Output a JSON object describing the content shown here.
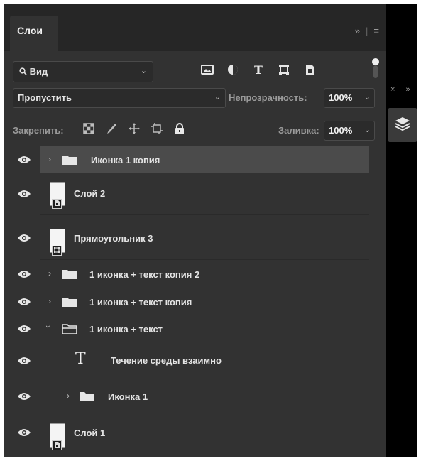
{
  "panel": {
    "tab_label": "Слои"
  },
  "header": {
    "expand_label": "»",
    "divider": "|",
    "menu_label": "≡"
  },
  "filter": {
    "label": "Вид",
    "chevron": "⌄"
  },
  "blend": {
    "mode": "Пропустить",
    "opacity_label": "Непрозрачность:",
    "opacity_value": "100%",
    "fill_label": "Заливка:",
    "fill_value": "100%"
  },
  "lock": {
    "label": "Закрепить:"
  },
  "layers": [
    {
      "name": "Иконка 1 копия",
      "kind": "group",
      "expanded": false,
      "selected": true
    },
    {
      "name": "Слой 2",
      "kind": "smart-object"
    },
    {
      "name": "Прямоугольник 3",
      "kind": "shape"
    },
    {
      "name": "1 иконка + текст копия 2",
      "kind": "group",
      "expanded": false
    },
    {
      "name": "1 иконка + текст копия",
      "kind": "group",
      "expanded": false
    },
    {
      "name": "1 иконка + текст",
      "kind": "group",
      "expanded": true
    },
    {
      "name": "Течение среды взаимно",
      "kind": "text",
      "indent": 1
    },
    {
      "name": "Иконка 1",
      "kind": "group",
      "expanded": false,
      "indent": 1
    },
    {
      "name": "Слой 1",
      "kind": "smart-object"
    }
  ],
  "strip": {
    "close_label": "×",
    "collapse_label": "»"
  }
}
